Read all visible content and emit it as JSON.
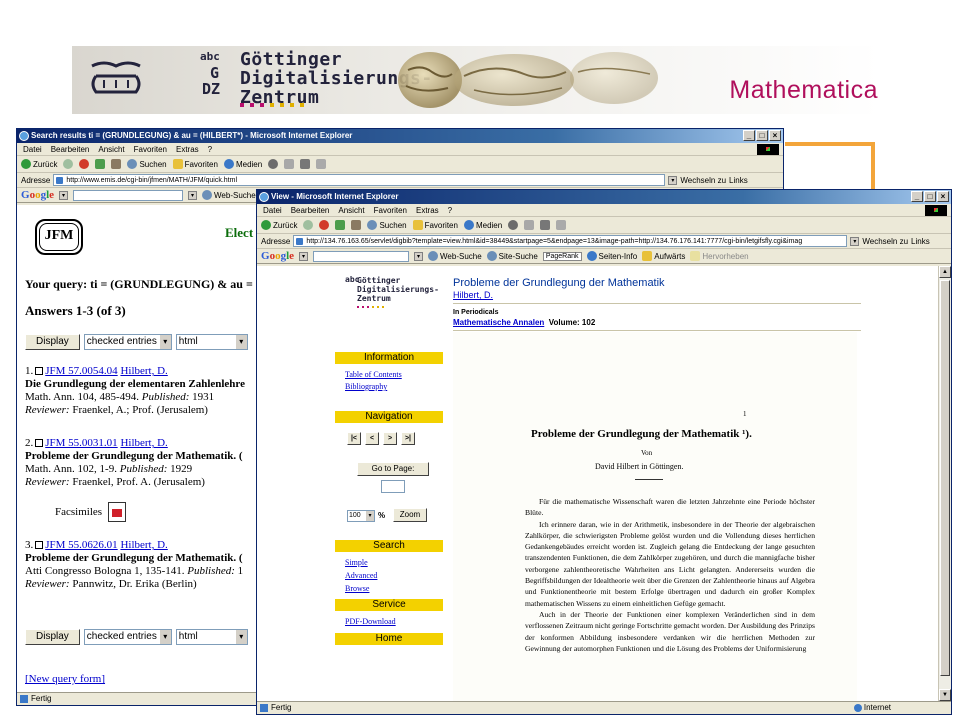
{
  "banner": {
    "title": "Mathematica",
    "gdz_name": "Göttinger Digitalisierungs- Zentrum",
    "gdz_line1": "Göttinger",
    "gdz_line2": "Digitalisierungs-",
    "gdz_line3": "Zentrum",
    "gdz_mark": [
      "abc",
      "G",
      "DZ"
    ],
    "colors": {
      "title": "#b00f5c",
      "accent": "#f3a53a",
      "dots_magenta": "#b90f6e",
      "dots_yellow": "#e0b000"
    }
  },
  "win1": {
    "title": "Search results ti = (GRUNDLEGUNG) & au = (HILBERT*) - Microsoft Internet Explorer",
    "menu": [
      "Datei",
      "Bearbeiten",
      "Ansicht",
      "Favoriten",
      "Extras",
      "?"
    ],
    "toolbar": {
      "back": "Zurück",
      "search": "Suchen",
      "favorites": "Favoriten",
      "media": "Medien"
    },
    "address_label": "Adresse",
    "address": "http://www.emis.de/cgi-bin/jfmen/MATH/JFM/quick.html",
    "go_label": "Wechseln zu",
    "links_label": "Links",
    "google_search": "Web-Suche",
    "status": "Fertig",
    "page": {
      "logo": "JFM",
      "elect": "Elect",
      "query": "Your query: ti = (GRUNDLEGUNG) & au = (HI",
      "answers": "Answers 1-3 (of 3)",
      "display_btn": "Display",
      "entries_select": "checked entries",
      "format_select": "html",
      "facsimiles": "Facsimiles",
      "new_query": "[New query form]",
      "results": [
        {
          "num": "1.",
          "jfm": "JFM 57.0054.04",
          "author": "Hilbert, D.",
          "title": "Die Grundlegung der elementaren Zahlenlehre",
          "source": "Math. Ann. 104, 485-494.",
          "published_label": "Published:",
          "published": "1931",
          "reviewer_label": "Reviewer:",
          "reviewer": "Fraenkel, A.; Prof. (Jerusalem)"
        },
        {
          "num": "2.",
          "jfm": "JFM 55.0031.01",
          "author": "Hilbert, D.",
          "title": "Probleme der Grundlegung der Mathematik. (",
          "source": "Math. Ann. 102, 1-9.",
          "published_label": "Published:",
          "published": "1929",
          "reviewer_label": "Reviewer:",
          "reviewer": "Fraenkel, Prof. A. (Jerusalem)"
        },
        {
          "num": "3.",
          "jfm": "JFM 55.0626.01",
          "author": "Hilbert, D.",
          "title": "Probleme der Grundlegung der Mathematik. (",
          "source": "Atti Congresso Bologna 1, 135-141.",
          "published_label": "Published:",
          "published": "1",
          "reviewer_label": "Reviewer:",
          "reviewer": "Pannwitz, Dr. Erika (Berlin)"
        }
      ]
    }
  },
  "win2": {
    "title": "View - Microsoft Internet Explorer",
    "menu": [
      "Datei",
      "Bearbeiten",
      "Ansicht",
      "Favoriten",
      "Extras",
      "?"
    ],
    "toolbar": {
      "back": "Zurück",
      "search": "Suchen",
      "favorites": "Favoriten",
      "media": "Medien"
    },
    "address_label": "Adresse",
    "address": "http://134.76.163.65/servlet/digbib?template=view.html&id=38449&startpage=5&endpage=13&image-path=http://134.76.176.141:7777/cgi-bin/letgifsfly.cgi&imag",
    "go_label": "Wechseln zu",
    "links_label": "Links",
    "google": {
      "web": "Web-Suche",
      "site": "Site-Suche",
      "pagerank": "PageRank",
      "info": "Seiten-Info",
      "up": "Aufwärts",
      "highlight": "Hervorheben"
    },
    "status": "Fertig",
    "zone": "Internet",
    "doc": {
      "title": "Probleme der Grundlegung der Mathematik",
      "author": "Hilbert, D.",
      "in_periodicals": "In Periodicals",
      "periodical": "Mathematische Annalen",
      "volume": "Volume: 102"
    },
    "sidebar": {
      "information": "Information",
      "toc": "Table of Contents",
      "bibliography": "Bibliography",
      "navigation": "Navigation",
      "nav_buttons": [
        "|<",
        "<",
        ">",
        ">|"
      ],
      "goto": "Go to Page:",
      "zoom_value": "100",
      "pct": "%",
      "zoom": "Zoom",
      "search": "Search",
      "simple": "Simple",
      "advanced": "Advanced",
      "browse": "Browse",
      "service": "Service",
      "pdf": "PDF-Download",
      "home": "Home"
    },
    "scan": {
      "page_no": "1",
      "title": "Probleme der Grundlegung der Mathematik ¹).",
      "von": "Von",
      "author": "David Hilbert in Göttingen.",
      "paragraphs": [
        "Für die mathematische Wissenschaft waren die letzten Jahrzehnte eine Periode höchster Blüte.",
        "Ich erinnere daran, wie in der Arithmetik, insbesondere in der Theorie der algebraischen Zahlkörper, die schwierigsten Probleme gelöst wurden und die Vollendung dieses herrlichen Gedankengebäudes erreicht worden ist. Zugleich gelang die Entdeckung der lange gesuchten transzendenten Funktionen, die dem Zahlkörper zugehören, und durch die mannigfache bisher verborgene zahlentheoretische Wahrheiten ans Licht gelangten. Andererseits wurden die Begriffsbildungen der Idealtheorie weit über die Grenzen der Zahlentheorie hinaus auf Algebra und Funktionentheorie mit bestem Erfolge übertragen und dadurch ein großer Komplex mathematischen Wissens zu einem einheitlichen Gefüge gemacht.",
        "Auch in der Theorie der Funktionen einer komplexen Veränderlichen sind in dem verflossenen Zeitraum nicht geringe Fortschritte gemacht worden. Der Ausbildung des Prinzips der konformen Abbildung insbesondere verdanken wir die herrlichen Methoden zur Gewinnung der automorphen Funktionen und die Lösung des Problems der Uniformisierung"
      ]
    }
  }
}
